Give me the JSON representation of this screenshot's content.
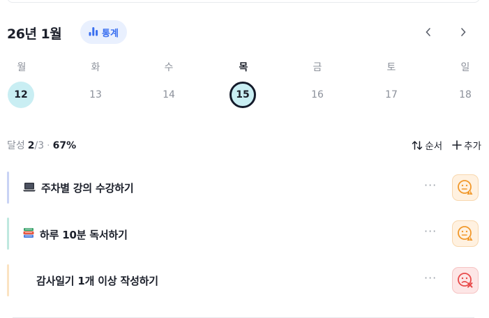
{
  "header": {
    "month_title": "26년 1월",
    "stats_label": "통계",
    "prev_label": "‹",
    "next_label": "›"
  },
  "weekdays": [
    "월",
    "화",
    "수",
    "목",
    "금",
    "토",
    "일"
  ],
  "days": [
    "12",
    "13",
    "14",
    "15",
    "16",
    "17",
    "18"
  ],
  "progress": {
    "label": "달성",
    "done": "2",
    "slash": "/",
    "total": "3",
    "separator": "·",
    "percent": "67%"
  },
  "actions": {
    "order_label": "순서",
    "add_label": "추가"
  },
  "tasks": [
    {
      "emoji": "💻",
      "title": "주차별 강의 수강하기",
      "more": "···",
      "status": "warning",
      "bar_color": "#c9d3f5"
    },
    {
      "emoji": "📚",
      "title": "하루 10분 독서하기",
      "more": "···",
      "status": "warning",
      "bar_color": "#bfe8df"
    },
    {
      "emoji": "",
      "title": "감사일기 1개 이상 작성하기",
      "more": "···",
      "status": "failed",
      "bar_color": "#fbe3c2"
    }
  ],
  "colors": {
    "accent": "#3a6ff0",
    "selected_day": "#c9eef3",
    "warning_bg": "#fff1e0",
    "warning_fg": "#f1982a",
    "failed_bg": "#fde6e6",
    "failed_fg": "#e84a4a"
  },
  "icons": {
    "stats": "bar-chart-icon",
    "order": "sort-arrows-icon",
    "add": "plus-icon",
    "warning": "face-warning-icon",
    "failed": "face-failed-icon"
  }
}
